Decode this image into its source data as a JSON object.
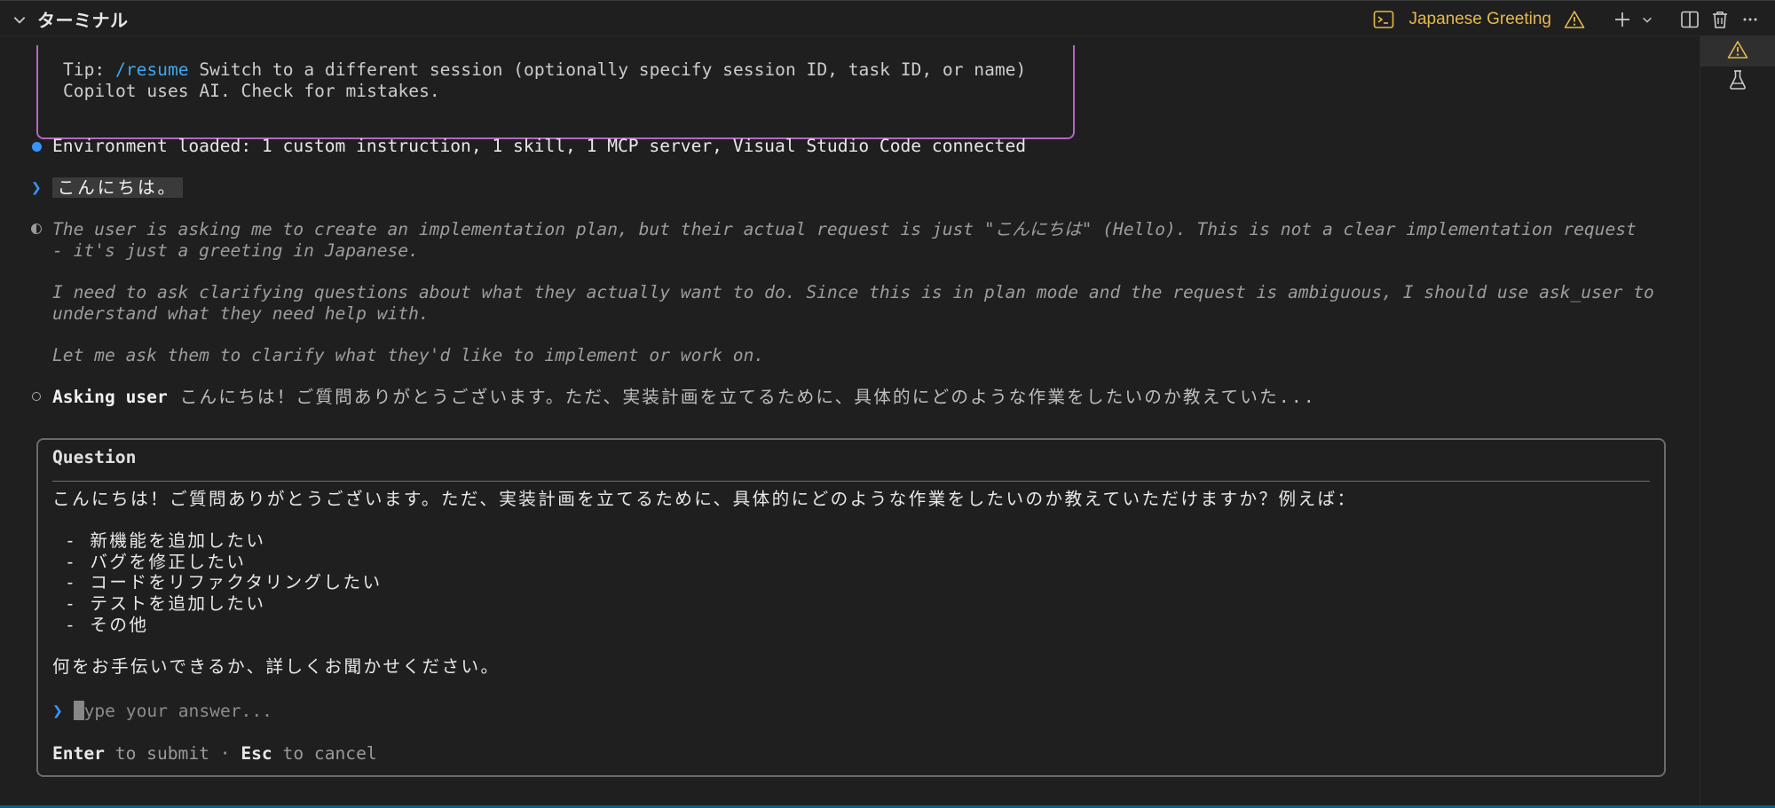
{
  "header": {
    "title": "ターミナル",
    "session_name": "Japanese Greeting"
  },
  "tip": {
    "prefix": "Tip: ",
    "command": "/resume",
    "text": " Switch to a different session (optionally specify session ID, task ID, or name)",
    "line2": "Copilot uses AI. Check for mistakes."
  },
  "env_status": "Environment loaded: 1 custom instruction, 1 skill, 1 MCP server, Visual Studio Code connected",
  "user_prompt": "こんにちは。",
  "thinking": {
    "line1": "The user is asking me to create an implementation plan, but their actual request is just \"こんにちは\" (Hello). This is not a clear implementation request",
    "line2": "- it's just a greeting in Japanese.",
    "line3": "I need to ask clarifying questions about what they actually want to do. Since this is in plan mode and the request is ambiguous, I should use ask_user to",
    "line4": "understand what they need help with.",
    "line5": "Let me ask them to clarify what they'd like to implement or work on."
  },
  "asking": {
    "label": "Asking user",
    "text": " こんにちは！ご質問ありがとうございます。ただ、実装計画を立てるために、具体的にどのような作業をしたいのか教えていた..."
  },
  "question": {
    "title": "Question",
    "intro": "こんにちは！ご質問ありがとうございます。ただ、実装計画を立てるために、具体的にどのような作業をしたいのか教えていただけますか？例えば：",
    "options": [
      "- 新機能を追加したい",
      "- バグを修正したい",
      "- コードをリファクタリングしたい",
      "- テストを追加したい",
      "- その他"
    ],
    "closing": "何をお手伝いできるか、詳しくお聞かせください。",
    "chevron": "❯",
    "cursor_char": "T",
    "placeholder": "ype your answer...",
    "enter_key": "Enter",
    "enter_text": " to submit · ",
    "esc_key": "Esc",
    "esc_text": " to cancel"
  },
  "prompt_chevron": "❯",
  "colors": {
    "accent_blue": "#3794ff",
    "tip_border": "#b565c8",
    "warning": "#e5b94e"
  },
  "icons": {
    "header": [
      "chevron-down-icon",
      "terminal-icon",
      "warning-icon",
      "plus-icon",
      "chevron-down-icon",
      "split-icon",
      "trash-icon",
      "more-icon"
    ],
    "sidebar": [
      "warning-icon",
      "flask-icon"
    ]
  }
}
